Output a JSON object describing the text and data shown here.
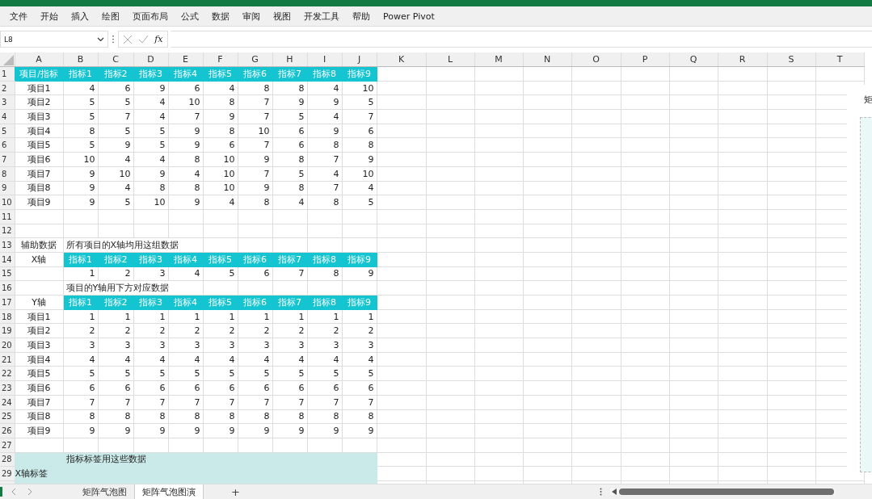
{
  "menu": [
    "文件",
    "开始",
    "插入",
    "绘图",
    "页面布局",
    "公式",
    "数据",
    "审阅",
    "视图",
    "开发工具",
    "帮助",
    "Power Pivot"
  ],
  "formula_bar": {
    "name_box": "L8",
    "more": "⋮",
    "function_label": "fx"
  },
  "columns": [
    "A",
    "B",
    "C",
    "D",
    "E",
    "F",
    "G",
    "H",
    "I",
    "J",
    "K",
    "L",
    "M",
    "N",
    "O",
    "P",
    "Q",
    "R",
    "S",
    "T"
  ],
  "rows": [
    {
      "row": "1",
      "kind": "header",
      "label": "项目/指标",
      "values": [
        "指标1",
        "指标2",
        "指标3",
        "指标4",
        "指标5",
        "指标6",
        "指标7",
        "指标8",
        "指标9"
      ]
    },
    {
      "row": "2",
      "kind": "data",
      "label": "项目1",
      "values": [
        "4",
        "6",
        "9",
        "6",
        "4",
        "8",
        "8",
        "4",
        "10"
      ]
    },
    {
      "row": "3",
      "kind": "data",
      "label": "项目2",
      "values": [
        "5",
        "5",
        "4",
        "10",
        "8",
        "7",
        "9",
        "9",
        "5"
      ]
    },
    {
      "row": "4",
      "kind": "data",
      "label": "项目3",
      "values": [
        "5",
        "7",
        "4",
        "7",
        "9",
        "7",
        "5",
        "4",
        "7"
      ]
    },
    {
      "row": "5",
      "kind": "data",
      "label": "项目4",
      "values": [
        "8",
        "5",
        "5",
        "9",
        "8",
        "10",
        "6",
        "9",
        "6"
      ]
    },
    {
      "row": "6",
      "kind": "data",
      "label": "项目5",
      "values": [
        "5",
        "9",
        "5",
        "9",
        "6",
        "7",
        "6",
        "8",
        "8"
      ]
    },
    {
      "row": "7",
      "kind": "data",
      "label": "项目6",
      "values": [
        "10",
        "4",
        "4",
        "8",
        "10",
        "9",
        "8",
        "7",
        "9"
      ]
    },
    {
      "row": "8",
      "kind": "data",
      "label": "项目7",
      "values": [
        "9",
        "10",
        "9",
        "4",
        "10",
        "7",
        "5",
        "4",
        "10"
      ]
    },
    {
      "row": "9",
      "kind": "data",
      "label": "项目8",
      "values": [
        "9",
        "4",
        "8",
        "8",
        "10",
        "9",
        "8",
        "7",
        "4"
      ]
    },
    {
      "row": "10",
      "kind": "data",
      "label": "项目9",
      "values": [
        "9",
        "5",
        "10",
        "9",
        "4",
        "8",
        "4",
        "8",
        "5"
      ]
    },
    {
      "row": "11",
      "kind": "empty"
    },
    {
      "row": "12",
      "kind": "empty"
    },
    {
      "row": "13",
      "kind": "note",
      "label": "辅助数据",
      "note": "所有项目的X轴均用这组数据"
    },
    {
      "row": "14",
      "kind": "axis",
      "label": "X轴",
      "values": [
        "指标1",
        "指标2",
        "指标3",
        "指标4",
        "指标5",
        "指标6",
        "指标7",
        "指标8",
        "指标9"
      ]
    },
    {
      "row": "15",
      "kind": "data",
      "values": [
        "1",
        "2",
        "3",
        "4",
        "5",
        "6",
        "7",
        "8",
        "9"
      ]
    },
    {
      "row": "16",
      "kind": "note",
      "note": "项目的Y轴用下方对应数据"
    },
    {
      "row": "17",
      "kind": "axis",
      "label": "Y轴",
      "values": [
        "指标1",
        "指标2",
        "指标3",
        "指标4",
        "指标5",
        "指标6",
        "指标7",
        "指标8",
        "指标9"
      ]
    },
    {
      "row": "18",
      "kind": "data",
      "label": "项目1",
      "values": [
        "1",
        "1",
        "1",
        "1",
        "1",
        "1",
        "1",
        "1",
        "1"
      ]
    },
    {
      "row": "19",
      "kind": "data",
      "label": "项目2",
      "values": [
        "2",
        "2",
        "2",
        "2",
        "2",
        "2",
        "2",
        "2",
        "2"
      ]
    },
    {
      "row": "20",
      "kind": "data",
      "label": "项目3",
      "values": [
        "3",
        "3",
        "3",
        "3",
        "3",
        "3",
        "3",
        "3",
        "3"
      ]
    },
    {
      "row": "21",
      "kind": "data",
      "label": "项目4",
      "values": [
        "4",
        "4",
        "4",
        "4",
        "4",
        "4",
        "4",
        "4",
        "4"
      ]
    },
    {
      "row": "22",
      "kind": "data",
      "label": "项目5",
      "values": [
        "5",
        "5",
        "5",
        "5",
        "5",
        "5",
        "5",
        "5",
        "5"
      ]
    },
    {
      "row": "23",
      "kind": "data",
      "label": "项目6",
      "values": [
        "6",
        "6",
        "6",
        "6",
        "6",
        "6",
        "6",
        "6",
        "6"
      ]
    },
    {
      "row": "24",
      "kind": "data",
      "label": "项目7",
      "values": [
        "7",
        "7",
        "7",
        "7",
        "7",
        "7",
        "7",
        "7",
        "7"
      ]
    },
    {
      "row": "25",
      "kind": "data",
      "label": "项目8",
      "values": [
        "8",
        "8",
        "8",
        "8",
        "8",
        "8",
        "8",
        "8",
        "8"
      ]
    },
    {
      "row": "26",
      "kind": "data",
      "label": "项目9",
      "values": [
        "9",
        "9",
        "9",
        "9",
        "9",
        "9",
        "9",
        "9",
        "9"
      ]
    },
    {
      "row": "27",
      "kind": "empty"
    },
    {
      "row": "28",
      "kind": "band",
      "note": "指标标签用这些数据"
    },
    {
      "row": "29",
      "kind": "band",
      "label": "X轴标签"
    }
  ],
  "chart_panel": {
    "title": "矩"
  },
  "sheet_tabs": [
    {
      "label": "矩阵气泡图",
      "selected": false
    },
    {
      "label": "矩阵气泡图演",
      "selected": true
    }
  ],
  "add_sheet": "+"
}
